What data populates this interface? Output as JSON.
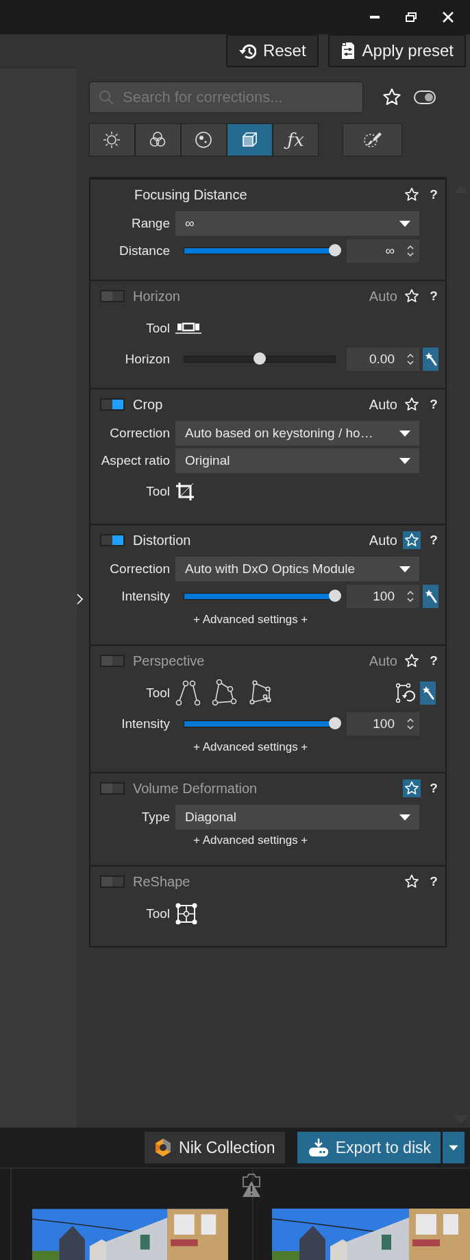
{
  "toolbar": {
    "buttons": [
      {
        "label": "Reset"
      },
      {
        "label": "Apply preset"
      }
    ]
  },
  "search": {
    "placeholder": "Search for corrections..."
  },
  "tabs": [
    {
      "selected": false
    },
    {
      "selected": false
    },
    {
      "selected": false
    },
    {
      "selected": true
    },
    {
      "selected": false,
      "label": "ƒx"
    },
    {
      "selected": false
    }
  ],
  "sections": [
    {
      "title": "Focusing Distance",
      "favorite": false,
      "help": "?",
      "rows": [
        {
          "kind": "dropdown",
          "label": "Range",
          "value": "∞"
        },
        {
          "kind": "slider",
          "label": "Distance",
          "level": 1,
          "reading": "∞"
        }
      ]
    },
    {
      "title": "Horizon",
      "on": false,
      "auto_label": "Auto",
      "favorite": false,
      "help": "?",
      "rows": [
        {
          "kind": "tool",
          "label": "Tool"
        },
        {
          "kind": "centered_slider",
          "label": "Horizon",
          "level": 0.5,
          "reading": "0.00",
          "auto_fix": true
        }
      ]
    },
    {
      "title": "Crop",
      "on": true,
      "auto_label": "Auto",
      "favorite": false,
      "help": "?",
      "rows": [
        {
          "kind": "dropdown",
          "label": "Correction",
          "value": "Auto based on keystoning / ho…"
        },
        {
          "kind": "dropdown",
          "label": "Aspect ratio",
          "value": "Original"
        },
        {
          "kind": "tool",
          "label": "Tool"
        }
      ]
    },
    {
      "title": "Distortion",
      "on": true,
      "auto_label": "Auto",
      "favorite": true,
      "help": "?",
      "rows": [
        {
          "kind": "dropdown",
          "label": "Correction",
          "value": "Auto with DxO Optics Module"
        },
        {
          "kind": "slider",
          "label": "Intensity",
          "level": 1,
          "reading": "100",
          "auto_fix": true
        },
        {
          "kind": "link",
          "text": "+ Advanced settings +"
        }
      ]
    },
    {
      "title": "Perspective",
      "on": false,
      "auto_label": "Auto",
      "favorite": false,
      "help": "?",
      "rows": [
        {
          "kind": "tool",
          "label": "Tool",
          "auto_fix": true
        },
        {
          "kind": "slider",
          "label": "Intensity",
          "level": 1,
          "reading": "100"
        },
        {
          "kind": "link",
          "text": "+ Advanced settings +"
        }
      ]
    },
    {
      "title": "Volume Deformation",
      "on": false,
      "favorite": true,
      "help": "?",
      "rows": [
        {
          "kind": "dropdown",
          "label": "Type",
          "value": "Diagonal"
        },
        {
          "kind": "link",
          "text": "+ Advanced settings +"
        }
      ]
    },
    {
      "title": "ReShape",
      "on": false,
      "favorite": false,
      "help": "?",
      "rows": [
        {
          "kind": "tool",
          "label": "Tool"
        }
      ]
    }
  ],
  "bottom_bar": {
    "buttons": [
      {
        "label": "Nik Collection"
      },
      {
        "label": "Export to disk"
      }
    ]
  }
}
